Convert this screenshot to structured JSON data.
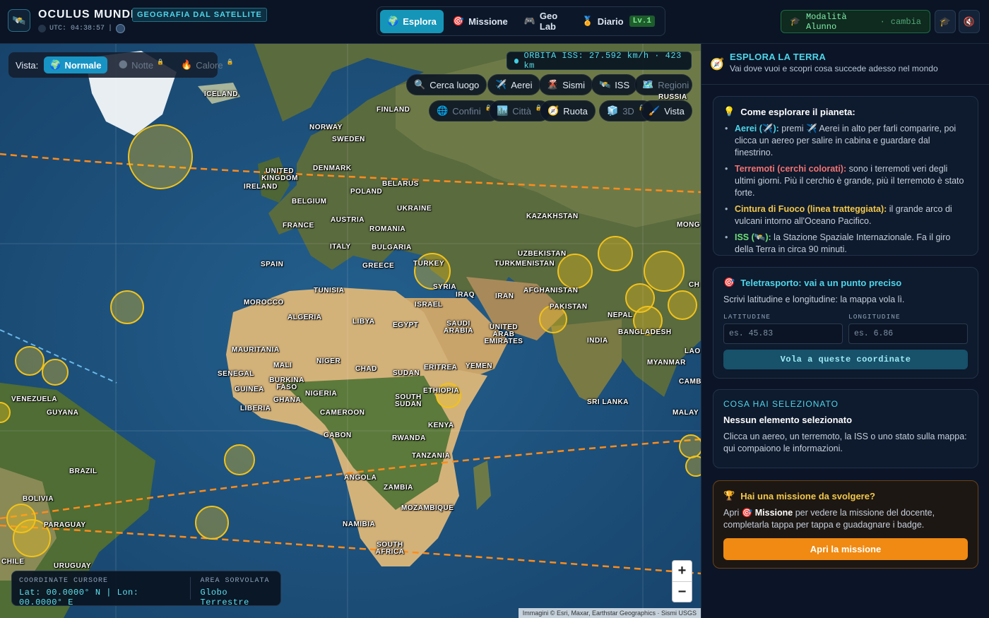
{
  "header": {
    "title": "OCULUS MUNDI",
    "badge": "GEOGRAFIA DAL SATELLITE",
    "utc": "UTC: 04:38:57",
    "separator": "|"
  },
  "nav": {
    "tabs": [
      {
        "label": "Esplora",
        "icon": "globe-icon"
      },
      {
        "label": "Missione",
        "icon": "target-icon"
      },
      {
        "label": "Geo Lab",
        "icon": "gamepad-icon"
      },
      {
        "label": "Diario",
        "icon": "medal-icon"
      }
    ],
    "level": "Lv.1"
  },
  "mode": {
    "label": "Modalità Alunno",
    "dot": "·",
    "change": "cambia"
  },
  "map": {
    "vista_label": "Vista:",
    "views": [
      "Normale",
      "Notte",
      "Calore"
    ],
    "iss_orbit": "ORBITA ISS: 27.592 km/h · 423 km",
    "tools_row1": [
      "Cerca luogo",
      "Aerei",
      "Sismi",
      "ISS",
      "Regioni"
    ],
    "tools_row2": [
      "Confini",
      "Città",
      "Ruota",
      "3D",
      "Vista"
    ],
    "countries": [
      "ICELAND",
      "FINLAND",
      "NORWAY",
      "SWEDEN",
      "UNITED KINGDOM",
      "IRELAND",
      "DENMARK",
      "BELARUS",
      "POLAND",
      "BELGIUM",
      "UKRAINE",
      "KAZAKHSTAN",
      "AUSTRIA",
      "FRANCE",
      "ROMANIA",
      "MONG",
      "ITALY",
      "BULGARIA",
      "SPAIN",
      "GREECE",
      "TURKEY",
      "UZBEKISTAN",
      "TURKMENISTAN",
      "TUNISIA",
      "SYRIA",
      "IRAQ",
      "IRAN",
      "AFGHANISTAN",
      "MOROCCO",
      "ISRAEL",
      "PAKISTAN",
      "ALGERIA",
      "LIBYA",
      "EGYPT",
      "SAUDI ARABIA",
      "NEPAL",
      "UNITED ARAB EMIRATES",
      "BANGLADESH",
      "INDIA",
      "MAURITANIA",
      "MALI",
      "NIGER",
      "CHAD",
      "SUDAN",
      "ERITREA",
      "YEMEN",
      "MYANMAR",
      "SENEGAL",
      "BURKINA FASO",
      "GUINEA",
      "NIGERIA",
      "ETHIOPIA",
      "GHANA",
      "LIBERIA",
      "CAMEROON",
      "SOUTH SUDAN",
      "SRI LANKA",
      "VENEZUELA",
      "GUYANA",
      "KENYA",
      "GABON",
      "RWANDA",
      "TANZANIA",
      "BRAZIL",
      "ANGOLA",
      "ZAMBIA",
      "BOLIVIA",
      "MOZAMBIQUE",
      "PARAGUAY",
      "NAMIBIA",
      "SOUTH AFRICA",
      "CHILE",
      "URUGUAY",
      "RUSSIA",
      "LAO",
      "CAMB",
      "MALAY",
      "CH"
    ],
    "coords_label": "COORDINATE CURSORE",
    "coords_value": "Lat: 00.0000° N | Lon: 00.0000° E",
    "area_label": "AREA SORVOLATA",
    "area_value": "Globo Terrestre",
    "zoom_in": "+",
    "zoom_out": "−",
    "attribution": "Immagini © Esri, Maxar, Earthstar Geographics · Sismi USGS"
  },
  "sidebar": {
    "title": "ESPLORA LA TERRA",
    "subtitle": "Vai dove vuoi e scopri cosa succede adesso nel mondo",
    "explore": {
      "heading": "Come esplorare il pianeta:",
      "items": [
        {
          "key": "Aerei (✈️):",
          "text": " premi ✈️ Aerei in alto per farli comparire, poi clicca un aereo per salire in cabina e guardare dal finestrino."
        },
        {
          "key": "Terremoti (cerchi colorati):",
          "text": " sono i terremoti veri degli ultimi giorni. Più il cerchio è grande, più il terremoto è stato forte."
        },
        {
          "key": "Cintura di Fuoco (linea tratteggiata):",
          "text": " il grande arco di vulcani intorno all'Oceano Pacifico."
        },
        {
          "key": "ISS (🛰️):",
          "text": " la Stazione Spaziale Internazionale. Fa il giro della Terra in circa 90 minuti."
        }
      ]
    },
    "teleport": {
      "heading": "Teletrasporto: vai a un punto preciso",
      "desc": "Scrivi latitudine e longitudine: la mappa vola lì.",
      "lat_label": "LATITUDINE",
      "lat_placeholder": "es. 45.83",
      "lon_label": "LONGITUDINE",
      "lon_placeholder": "es. 6.86",
      "button": "Vola a queste coordinate"
    },
    "selection": {
      "label": "COSA HAI SELEZIONATO",
      "title": "Nessun elemento selezionato",
      "desc": "Clicca un aereo, un terremoto, la ISS o uno stato sulla mappa: qui compaiono le informazioni."
    },
    "mission": {
      "heading": "Hai una missione da svolgere?",
      "pre": "Apri ",
      "key": "Missione",
      "post": " per vedere la missione del docente, completarla tappa per tappa e guadagnare i badge.",
      "button": "Apri la missione"
    }
  },
  "colors": {
    "accent": "#1596b8",
    "cyan": "#4fd6ea",
    "orange": "#f08a12",
    "quake": "#f2c21b",
    "fire_ring": "#ff8c1a"
  }
}
